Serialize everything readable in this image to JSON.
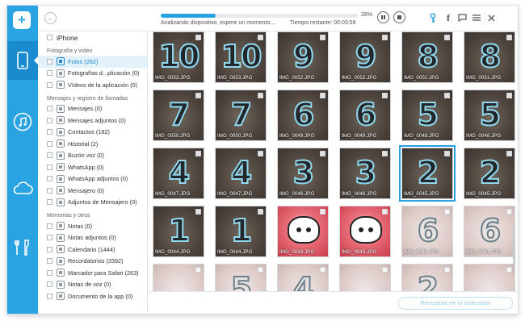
{
  "header": {
    "status": "Analizando dispositivo, espere un momento...",
    "time_label": "Tiempo restante: 00:03:58",
    "progress_pct": "28%",
    "progress": 0.28
  },
  "sidebar": {
    "device": "iPhone",
    "sections": [
      {
        "title": "Fotografía y vídeo",
        "items": [
          {
            "label": "Fotos (262)",
            "active": true
          },
          {
            "label": "Fotografías d...plicación (0)"
          },
          {
            "label": "Vídeos de la aplicación (0)"
          }
        ]
      },
      {
        "title": "Mensajes y registro de llamadas",
        "items": [
          {
            "label": "Mensajes (0)"
          },
          {
            "label": "Mensajes adjuntos (0)"
          },
          {
            "label": "Contactos (182)"
          },
          {
            "label": "Historial (2)"
          },
          {
            "label": "Buzón voz (0)"
          },
          {
            "label": "WhatsApp (0)"
          },
          {
            "label": "WhatsApp adjuntos (0)"
          },
          {
            "label": "Mensajero (0)"
          },
          {
            "label": "Adjuntos de Mensajero (0)"
          }
        ]
      },
      {
        "title": "Memorias y otros",
        "items": [
          {
            "label": "Notas (0)"
          },
          {
            "label": "Notas adjuntos (0)"
          },
          {
            "label": "Calendario (1444)"
          },
          {
            "label": "Recordatorios (3392)"
          },
          {
            "label": "Marcador para Safari (263)"
          },
          {
            "label": "Notas de voz (0)"
          },
          {
            "label": "Documento de la app (0)"
          }
        ]
      }
    ]
  },
  "grid": {
    "rows": [
      [
        {
          "digit": "10",
          "name": "IMG_0053.JPG"
        },
        {
          "digit": "10",
          "name": "IMG_0053.JPG"
        },
        {
          "digit": "9",
          "name": "IMG_0052.JPG"
        },
        {
          "digit": "9",
          "name": "IMG_0052.JPG"
        },
        {
          "digit": "8",
          "name": "IMG_0051.JPG"
        },
        {
          "digit": "8",
          "name": "IMG_0051.JPG"
        }
      ],
      [
        {
          "digit": "7",
          "name": "IMG_0050.JPG"
        },
        {
          "digit": "7",
          "name": "IMG_0050.JPG"
        },
        {
          "digit": "6",
          "name": "IMG_0049.JPG"
        },
        {
          "digit": "6",
          "name": "IMG_0049.JPG"
        },
        {
          "digit": "5",
          "name": "IMG_0048.JPG"
        },
        {
          "digit": "5",
          "name": "IMG_0048.JPG"
        }
      ],
      [
        {
          "digit": "4",
          "name": "IMG_0047.JPG"
        },
        {
          "digit": "4",
          "name": "IMG_0047.JPG"
        },
        {
          "digit": "3",
          "name": "IMG_0046.JPG"
        },
        {
          "digit": "3",
          "name": "IMG_0046.JPG"
        },
        {
          "digit": "2",
          "name": "IMG_0045.JPG",
          "selected": true
        },
        {
          "digit": "2",
          "name": "IMG_0045.JPG"
        }
      ],
      [
        {
          "digit": "1",
          "name": "IMG_0044.JPG"
        },
        {
          "digit": "1",
          "name": "IMG_0044.JPG"
        },
        {
          "digit": "",
          "name": "IMG_0043.JPG",
          "kind": "pink"
        },
        {
          "digit": "",
          "name": "IMG_0043.JPG",
          "kind": "pink"
        },
        {
          "digit": "6",
          "name": "IMG_0042.JPG",
          "kind": "pale"
        },
        {
          "digit": "6",
          "name": "IMG_0041.JPG",
          "kind": "pale"
        }
      ],
      [
        {
          "digit": "",
          "name": "",
          "kind": "pale"
        },
        {
          "digit": "5",
          "name": "",
          "kind": "pale"
        },
        {
          "digit": "4",
          "name": "",
          "kind": "pale"
        },
        {
          "digit": "",
          "name": "",
          "kind": "pale"
        },
        {
          "digit": "2",
          "name": "",
          "kind": "pale"
        },
        {
          "digit": "",
          "name": "",
          "kind": "pale"
        }
      ]
    ]
  },
  "footer": {
    "recover_label": "Recuperar en el ordenador"
  }
}
